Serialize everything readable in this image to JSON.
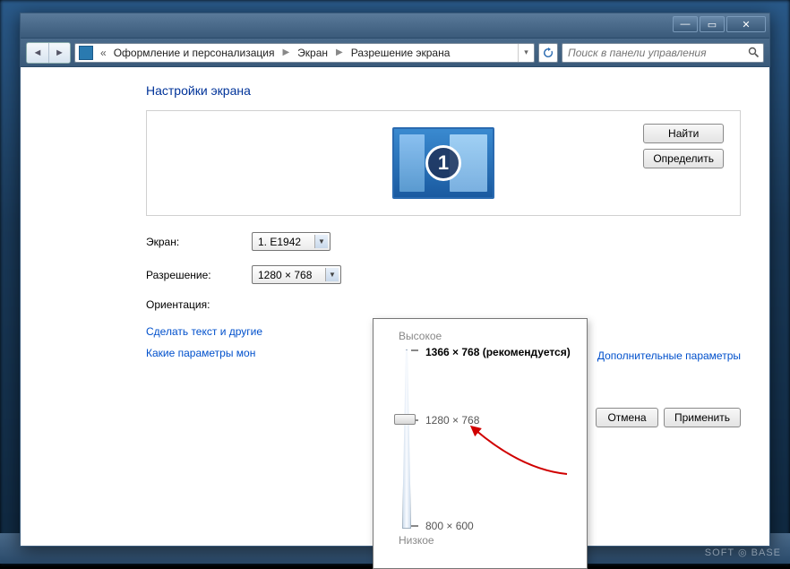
{
  "window": {
    "minimize_glyph": "—",
    "maximize_glyph": "▭",
    "close_glyph": "✕"
  },
  "breadcrumb": {
    "prefix": "«",
    "items": [
      "Оформление и персонализация",
      "Экран",
      "Разрешение экрана"
    ]
  },
  "search": {
    "placeholder": "Поиск в панели управления"
  },
  "page": {
    "title": "Настройки экрана",
    "monitor_number": "1",
    "find_btn": "Найти",
    "detect_btn": "Определить"
  },
  "form": {
    "screen_label": "Экран:",
    "screen_value": "1. E1942",
    "resolution_label": "Разрешение:",
    "resolution_value": "1280 × 768",
    "orientation_label": "Ориентация:"
  },
  "links": {
    "advanced": "Дополнительные параметры",
    "text_size": "Сделать текст и другие",
    "which_params": "Какие параметры мон"
  },
  "actions": {
    "cancel": "Отмена",
    "apply": "Применить"
  },
  "slider": {
    "high_label": "Высокое",
    "low_label": "Низкое",
    "recommended": "1366 × 768 (рекомендуется)",
    "current": "1280 × 768",
    "min": "800 × 600"
  },
  "watermark": "SOFT ◎ BASE"
}
